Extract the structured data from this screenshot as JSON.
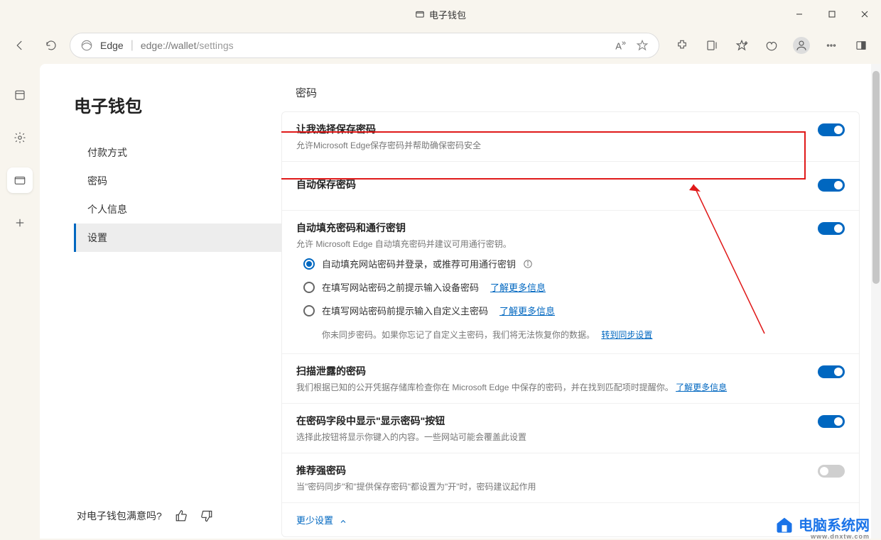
{
  "window": {
    "title": "电子钱包"
  },
  "nav": {
    "brand": "Edge",
    "url_prefix": "edge://wallet",
    "url_path": "/settings",
    "aa_label": "A"
  },
  "sidebar": {
    "title": "电子钱包",
    "items": [
      {
        "label": "付款方式"
      },
      {
        "label": "密码"
      },
      {
        "label": "个人信息"
      },
      {
        "label": "设置"
      }
    ],
    "active_index": 3,
    "feedback": "对电子钱包满意吗?"
  },
  "settings": {
    "header": "密码",
    "rows": [
      {
        "title": "让我选择保存密码",
        "desc": "允许Microsoft Edge保存密码并帮助确保密码安全",
        "toggle": true
      },
      {
        "title": "自动保存密码",
        "desc": "",
        "toggle": true,
        "highlighted": true
      },
      {
        "title": "自动填充密码和通行密钥",
        "desc": "允许 Microsoft Edge 自动填充密码并建议可用通行密钥。",
        "toggle": true,
        "radios": [
          {
            "label": "自动填充网站密码并登录，或推荐可用通行密钥",
            "checked": true,
            "info": true
          },
          {
            "label": "在填写网站密码之前提示输入设备密码",
            "checked": false,
            "link": "了解更多信息"
          },
          {
            "label": "在填写网站密码前提示输入自定义主密码",
            "checked": false,
            "link": "了解更多信息"
          }
        ],
        "sync_note": "你未同步密码。如果你忘记了自定义主密码，我们将无法恢复你的数据。",
        "sync_link": "转到同步设置"
      },
      {
        "title": "扫描泄露的密码",
        "desc_pre": "我们根据已知的公开凭据存储库检查你在 Microsoft Edge 中保存的密码，并在找到匹配项时提醒你。",
        "desc_link": "了解更多信息",
        "toggle": true
      },
      {
        "title": "在密码字段中显示\"显示密码\"按钮",
        "desc": "选择此按钮将显示你键入的内容。一些网站可能会覆盖此设置",
        "toggle": true
      },
      {
        "title": "推荐强密码",
        "desc": "当\"密码同步\"和\"提供保存密码\"都设置为\"开\"时，密码建议起作用",
        "toggle": false
      }
    ],
    "less": "更少设置"
  },
  "watermark": {
    "text": "电脑系统网",
    "sub": "www.dnxtw.com"
  }
}
